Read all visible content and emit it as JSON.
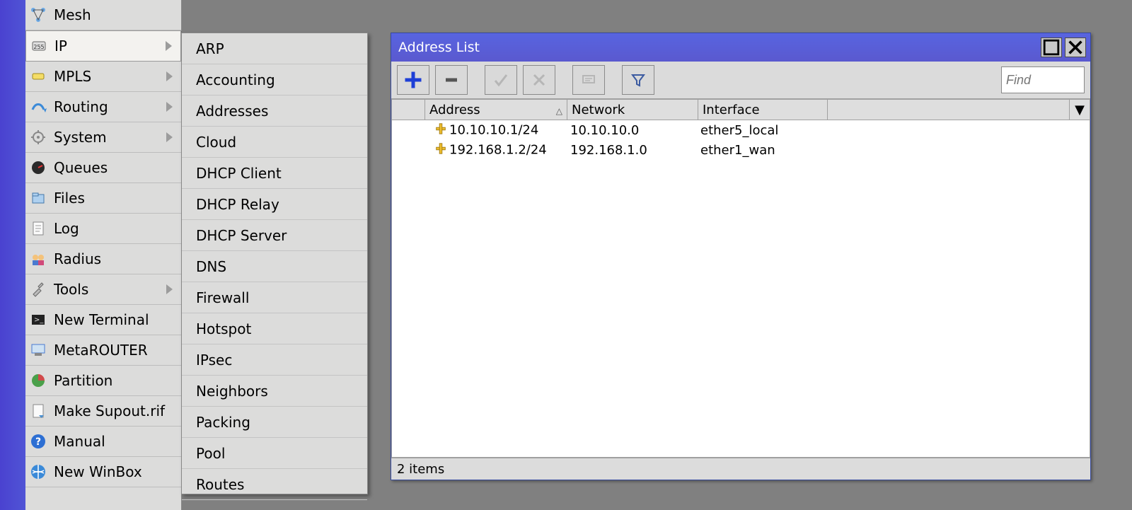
{
  "sidebar": {
    "items": [
      {
        "label": "Mesh",
        "icon": "mesh",
        "sub": false
      },
      {
        "label": "IP",
        "icon": "ip",
        "sub": true,
        "selected": true
      },
      {
        "label": "MPLS",
        "icon": "mpls",
        "sub": true
      },
      {
        "label": "Routing",
        "icon": "routing",
        "sub": true
      },
      {
        "label": "System",
        "icon": "system",
        "sub": true
      },
      {
        "label": "Queues",
        "icon": "queues",
        "sub": false
      },
      {
        "label": "Files",
        "icon": "files",
        "sub": false
      },
      {
        "label": "Log",
        "icon": "log",
        "sub": false
      },
      {
        "label": "Radius",
        "icon": "radius",
        "sub": false
      },
      {
        "label": "Tools",
        "icon": "tools",
        "sub": true
      },
      {
        "label": "New Terminal",
        "icon": "terminal",
        "sub": false
      },
      {
        "label": "MetaROUTER",
        "icon": "metarouter",
        "sub": false
      },
      {
        "label": "Partition",
        "icon": "partition",
        "sub": false
      },
      {
        "label": "Make Supout.rif",
        "icon": "supout",
        "sub": false
      },
      {
        "label": "Manual",
        "icon": "manual",
        "sub": false
      },
      {
        "label": "New WinBox",
        "icon": "winbox",
        "sub": false
      }
    ]
  },
  "submenu": {
    "items": [
      {
        "label": "ARP"
      },
      {
        "label": "Accounting"
      },
      {
        "label": "Addresses"
      },
      {
        "label": "Cloud"
      },
      {
        "label": "DHCP Client"
      },
      {
        "label": "DHCP Relay"
      },
      {
        "label": "DHCP Server"
      },
      {
        "label": "DNS"
      },
      {
        "label": "Firewall"
      },
      {
        "label": "Hotspot"
      },
      {
        "label": "IPsec"
      },
      {
        "label": "Neighbors"
      },
      {
        "label": "Packing"
      },
      {
        "label": "Pool"
      },
      {
        "label": "Routes"
      }
    ]
  },
  "window": {
    "title": "Address List",
    "find_placeholder": "Find",
    "columns": {
      "address": "Address",
      "network": "Network",
      "interface": "Interface"
    },
    "rows": [
      {
        "address": "10.10.10.1/24",
        "network": "10.10.10.0",
        "interface": "ether5_local"
      },
      {
        "address": "192.168.1.2/24",
        "network": "192.168.1.0",
        "interface": "ether1_wan"
      }
    ],
    "status": "2 items"
  }
}
